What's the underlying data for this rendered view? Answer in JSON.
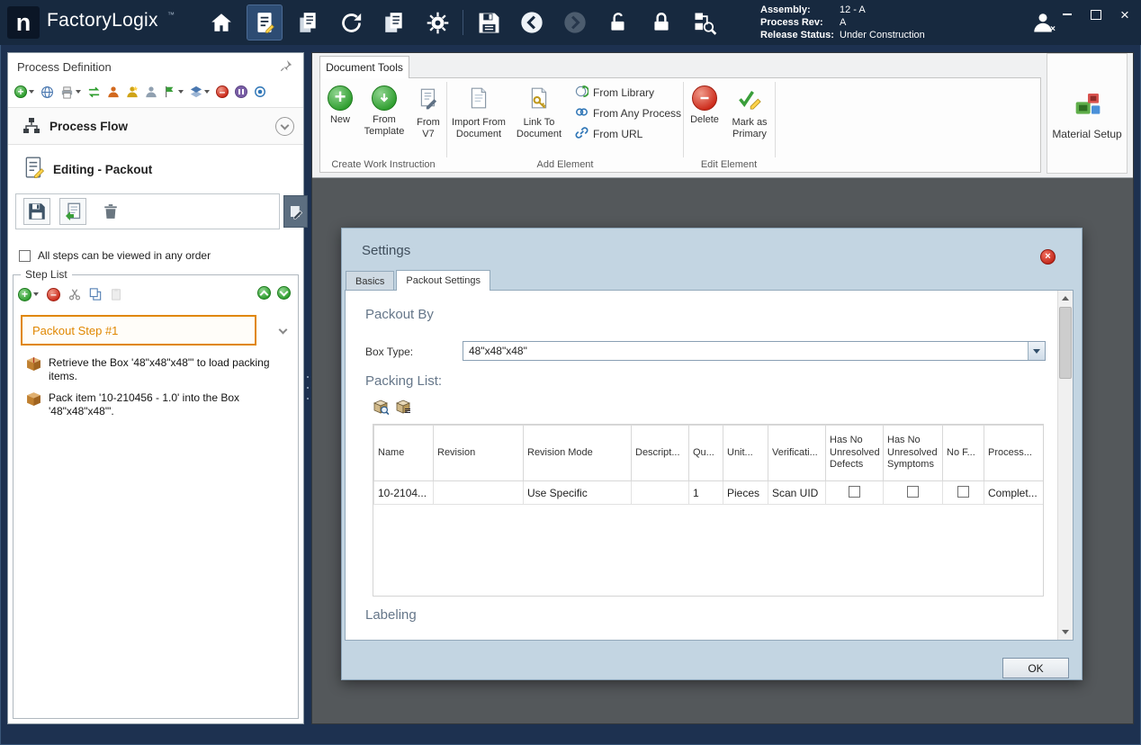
{
  "titlebar": {
    "app_name": "FactoryLogix",
    "trademark": "™",
    "info": {
      "assembly_label": "Assembly:",
      "assembly_value": "12 - A",
      "process_rev_label": "Process Rev:",
      "process_rev_value": "A",
      "release_status_label": "Release Status:",
      "release_status_value": "Under Construction"
    }
  },
  "left_panel": {
    "title": "Process Definition",
    "process_flow": "Process Flow",
    "editing": "Editing - Packout",
    "all_steps_label": "All steps can be viewed in any order",
    "step_list": {
      "title": "Step List",
      "selected_step": "Packout Step #1",
      "steps": [
        "Retrieve the Box '48\"x48\"x48\"' to load packing items.",
        "Pack item '10-210456 - 1.0' into the Box '48\"x48\"x48\"'."
      ]
    }
  },
  "ribbon": {
    "tab": "Document Tools",
    "create_group": {
      "label": "Create Work Instruction",
      "new": "New",
      "from_template": "From Template",
      "from_v7": "From V7"
    },
    "add_group": {
      "label": "Add Element",
      "import_from_document": "Import From Document",
      "link_to_document": "Link To Document",
      "from_library": "From Library",
      "from_any_process": "From Any Process",
      "from_url": "From URL"
    },
    "edit_group": {
      "label": "Edit Element",
      "delete": "Delete",
      "mark_as_primary": "Mark as Primary"
    },
    "material_setup": "Material Setup"
  },
  "dialog": {
    "title": "Settings",
    "tabs": {
      "basics": "Basics",
      "packout": "Packout Settings"
    },
    "packout_by_heading": "Packout By",
    "box_type_label": "Box Type:",
    "box_type_value": "48\"x48\"x48\"",
    "packing_list_heading": "Packing List:",
    "table": {
      "columns": [
        "Name",
        "Revision",
        "Revision Mode",
        "Descript...",
        "Qu...",
        "Unit...",
        "Verificati...",
        "Has No Unresolved Defects",
        "Has No Unresolved Symptoms",
        "No F...",
        "Process..."
      ],
      "row": {
        "name": "10-2104...",
        "revision": "",
        "revision_mode": "Use Specific",
        "description": "",
        "quantity": "1",
        "units": "Pieces",
        "verification": "Scan UID",
        "process": "Complet..."
      }
    },
    "labeling_heading": "Labeling",
    "ok": "OK"
  }
}
